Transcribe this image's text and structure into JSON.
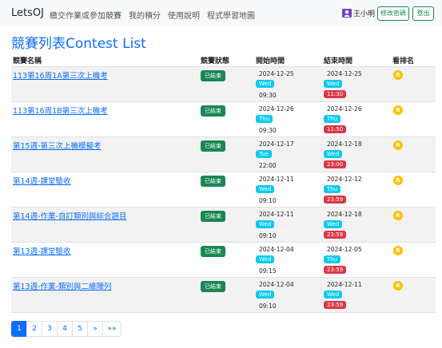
{
  "brand": "LetsOJ",
  "nav": [
    "繳交作業或參加競賽",
    "我的積分",
    "使用說明",
    "程式學習地圖"
  ],
  "user": {
    "name": "王小明",
    "icon": "user-avatar-icon"
  },
  "buttons": {
    "change_password": "修改密碼",
    "logout": "登出"
  },
  "page_title": "競賽列表Contest List",
  "columns": {
    "name": "競賽名稱",
    "status": "競賽狀態",
    "start": "開始時間",
    "end": "結束時間",
    "rank": "看排名"
  },
  "contests": [
    {
      "name": "113第16周1A第三次上機考",
      "status": "已結束",
      "start_date": "2024-12-25",
      "start_day": "Wed",
      "start_time": "09:30",
      "end_date": "2024-12-25",
      "end_day": "Wed",
      "end_time": "11:30",
      "rank": "R"
    },
    {
      "name": "113第16周1B第三次上機考",
      "status": "已結束",
      "start_date": "2024-12-26",
      "start_day": "Thu",
      "start_time": "09:30",
      "end_date": "2024-12-26",
      "end_day": "Thu",
      "end_time": "11:50",
      "rank": "R"
    },
    {
      "name": "第15週-第三次上機模擬考",
      "status": "已結束",
      "start_date": "2024-12-17",
      "start_day": "Tue",
      "start_time": "22:00",
      "end_date": "2024-12-18",
      "end_day": "Wed",
      "end_time": "23:00",
      "rank": "R"
    },
    {
      "name": "第14週-課堂驗收",
      "status": "已結束",
      "start_date": "2024-12-11",
      "start_day": "Wed",
      "start_time": "09:10",
      "end_date": "2024-12-12",
      "end_day": "Thu",
      "end_time": "23:59",
      "rank": "R"
    },
    {
      "name": "第14週-作業-自訂類別與綜合題目",
      "status": "已結束",
      "start_date": "2024-12-11",
      "start_day": "Wed",
      "start_time": "09:10",
      "end_date": "2024-12-18",
      "end_day": "Wed",
      "end_time": "23:59",
      "rank": "R"
    },
    {
      "name": "第13週-課堂驗收",
      "status": "已結束",
      "start_date": "2024-12-04",
      "start_day": "Wed",
      "start_time": "09:15",
      "end_date": "2024-12-05",
      "end_day": "Thu",
      "end_time": "23:59",
      "rank": "R"
    },
    {
      "name": "第13週-作業-類別與二維陣列",
      "status": "已結束",
      "start_date": "2024-12-04",
      "start_day": "Wed",
      "start_time": "09:10",
      "end_date": "2024-12-11",
      "end_day": "Wed",
      "end_time": "23:59",
      "rank": "R"
    }
  ],
  "pagination": [
    "1",
    "2",
    "3",
    "4",
    "5",
    "»",
    "»»"
  ],
  "active_page": "1",
  "colors": {
    "primary": "#0d6efd",
    "success": "#198754",
    "info": "#0dcaf0",
    "danger": "#dc3545",
    "warning": "#ffc107"
  }
}
